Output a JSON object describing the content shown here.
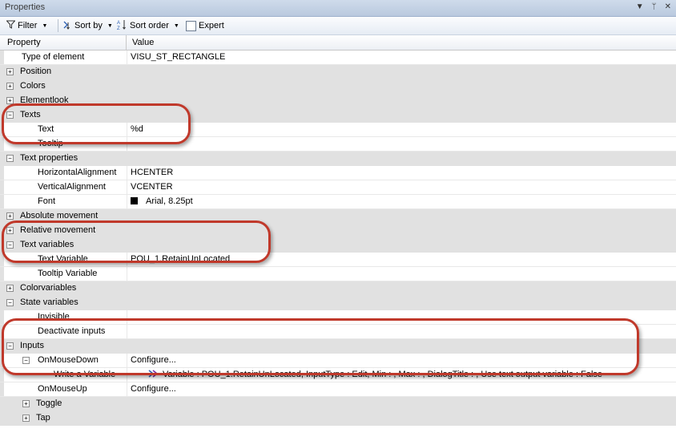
{
  "window": {
    "title": "Properties"
  },
  "toolbar": {
    "filter_label": "Filter",
    "sortby_label": "Sort by",
    "sortorder_label": "Sort order",
    "expert_label": "Expert"
  },
  "grid": {
    "col_property": "Property",
    "col_value": "Value",
    "rows": [
      {
        "name": "Type of element",
        "value": "VISU_ST_RECTANGLE",
        "level": 1,
        "cat": false,
        "exp": ""
      },
      {
        "name": "Position",
        "value": "",
        "level": 0,
        "cat": true,
        "exp": "+"
      },
      {
        "name": "Colors",
        "value": "",
        "level": 0,
        "cat": true,
        "exp": "+"
      },
      {
        "name": "Elementlook",
        "value": "",
        "level": 0,
        "cat": true,
        "exp": "+"
      },
      {
        "name": "Texts",
        "value": "",
        "level": 0,
        "cat": true,
        "exp": "-"
      },
      {
        "name": "Text",
        "value": "%d",
        "level": 2,
        "cat": false,
        "exp": ""
      },
      {
        "name": "Tooltip",
        "value": "",
        "level": 2,
        "cat": false,
        "exp": ""
      },
      {
        "name": "Text properties",
        "value": "",
        "level": 0,
        "cat": true,
        "exp": "-"
      },
      {
        "name": "HorizontalAlignment",
        "value": "HCENTER",
        "level": 2,
        "cat": false,
        "exp": ""
      },
      {
        "name": "VerticalAlignment",
        "value": "VCENTER",
        "level": 2,
        "cat": false,
        "exp": ""
      },
      {
        "name": "Font",
        "value": "Arial, 8.25pt",
        "level": 2,
        "cat": false,
        "exp": "",
        "swatch": true
      },
      {
        "name": "Absolute movement",
        "value": "",
        "level": 0,
        "cat": true,
        "exp": "+"
      },
      {
        "name": "Relative movement",
        "value": "",
        "level": 0,
        "cat": true,
        "exp": "+"
      },
      {
        "name": "Text variables",
        "value": "",
        "level": 0,
        "cat": true,
        "exp": "-"
      },
      {
        "name": "Text Variable",
        "value": "POU_1.RetainUnLocated",
        "level": 2,
        "cat": false,
        "exp": ""
      },
      {
        "name": "Tooltip Variable",
        "value": "",
        "level": 2,
        "cat": false,
        "exp": ""
      },
      {
        "name": "Colorvariables",
        "value": "",
        "level": 0,
        "cat": true,
        "exp": "+"
      },
      {
        "name": "State variables",
        "value": "",
        "level": 0,
        "cat": true,
        "exp": "-"
      },
      {
        "name": "Invisible",
        "value": "",
        "level": 2,
        "cat": false,
        "exp": ""
      },
      {
        "name": "Deactivate inputs",
        "value": "",
        "level": 2,
        "cat": false,
        "exp": ""
      },
      {
        "name": "Inputs",
        "value": "",
        "level": 0,
        "cat": true,
        "exp": "-"
      },
      {
        "name": "OnMouseDown",
        "value": "Configure...",
        "level": 2,
        "cat": false,
        "exp": "-"
      },
      {
        "name": "Write a Variable",
        "value": "Variable : POU_1.RetainUnLocated, InputType : Edit, Min : , Max : , DialogTitle : , Use text output variable : False",
        "level": 3,
        "cat": false,
        "exp": "",
        "varicon": true
      },
      {
        "name": "OnMouseUp",
        "value": "Configure...",
        "level": 2,
        "cat": false,
        "exp": ""
      },
      {
        "name": "Toggle",
        "value": "",
        "level": 2,
        "cat": true,
        "exp": "+"
      },
      {
        "name": "Tap",
        "value": "",
        "level": 2,
        "cat": true,
        "exp": "+"
      }
    ]
  },
  "colors": {
    "highlight": "#c0392b",
    "category_bg": "#e1e1e1"
  }
}
